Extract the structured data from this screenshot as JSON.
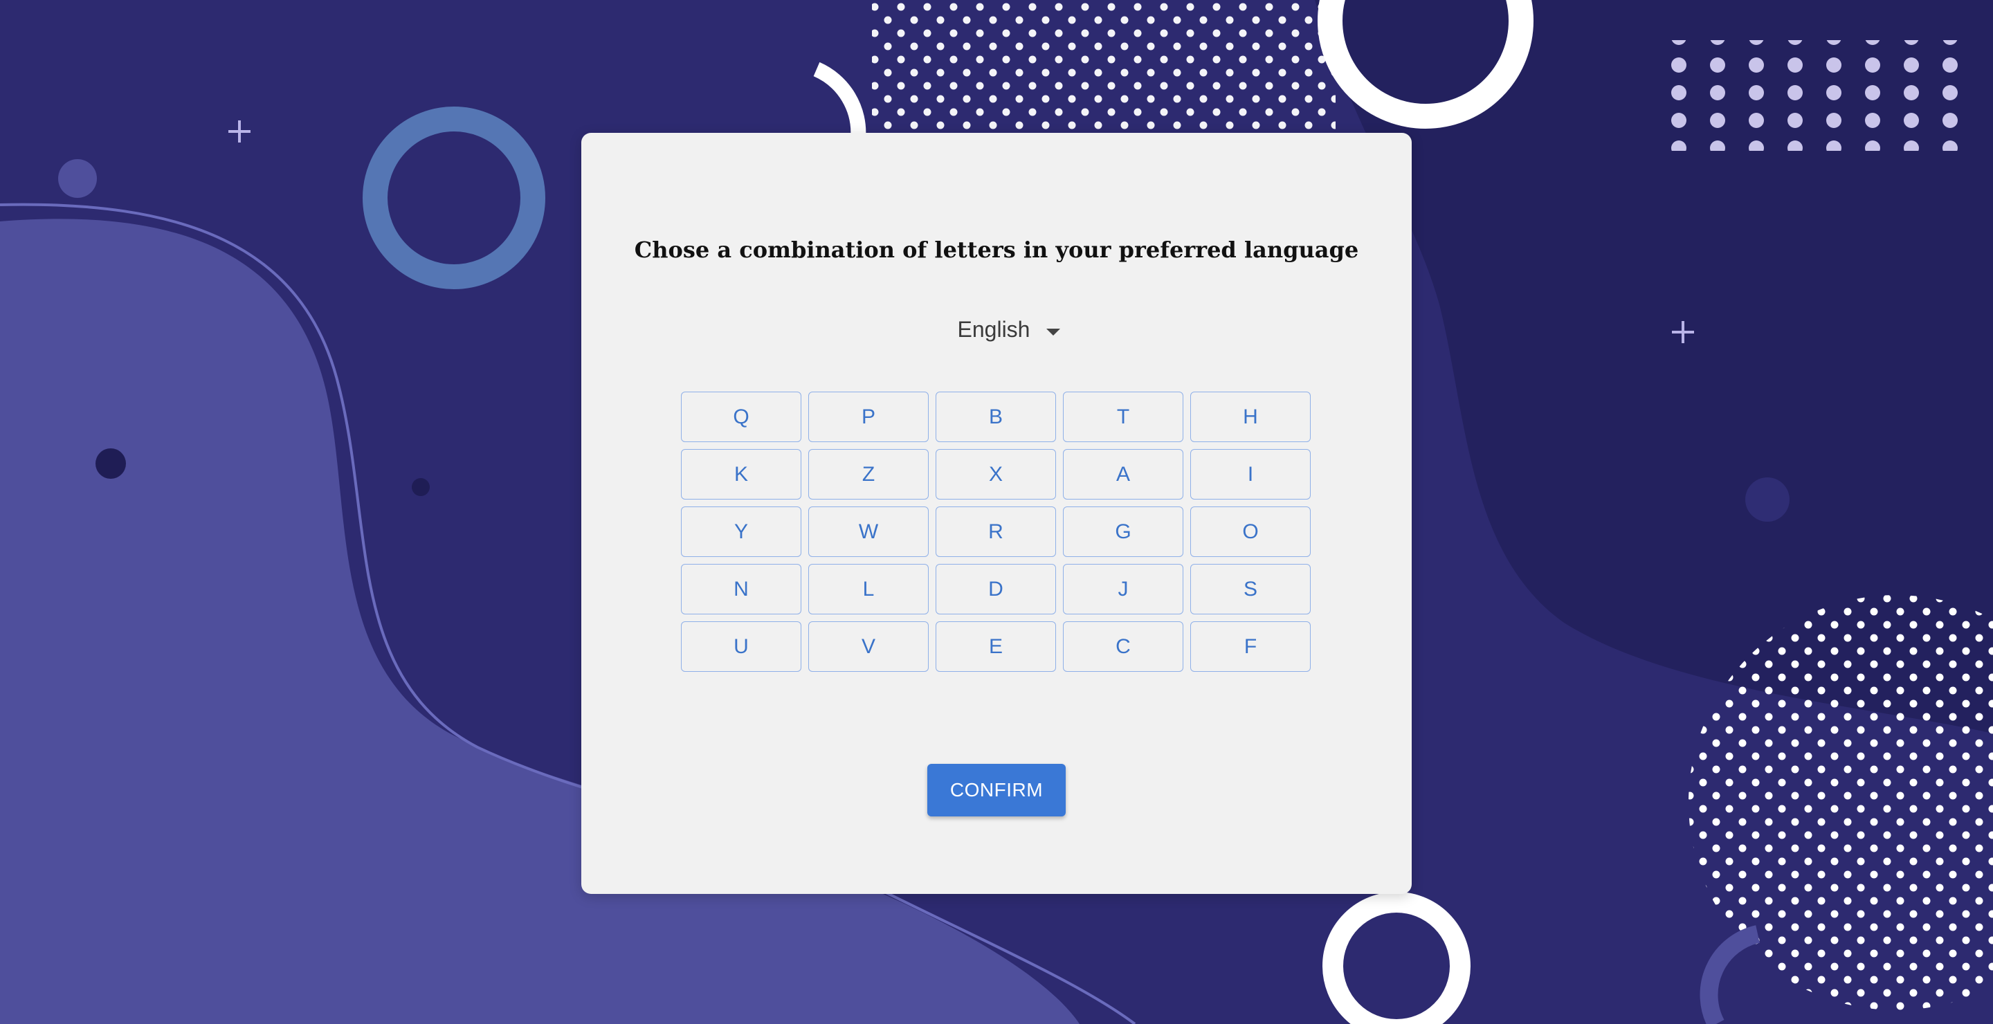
{
  "dialog": {
    "title": "Chose a combination of letters in your preferred language",
    "language": {
      "selected": "English",
      "icon": "caret-down-icon"
    },
    "letters": [
      [
        "Q",
        "P",
        "B",
        "T",
        "H"
      ],
      [
        "K",
        "Z",
        "X",
        "A",
        "I"
      ],
      [
        "Y",
        "W",
        "R",
        "G",
        "O"
      ],
      [
        "N",
        "L",
        "D",
        "J",
        "S"
      ],
      [
        "U",
        "V",
        "E",
        "C",
        "F"
      ]
    ],
    "confirm_label": "CONFIRM"
  },
  "colors": {
    "background": "#2d2a70",
    "card": "#f1f1f1",
    "letter_border": "#8fb0e8",
    "letter_text": "#3a73c9",
    "confirm_bg": "#3a78d6"
  }
}
